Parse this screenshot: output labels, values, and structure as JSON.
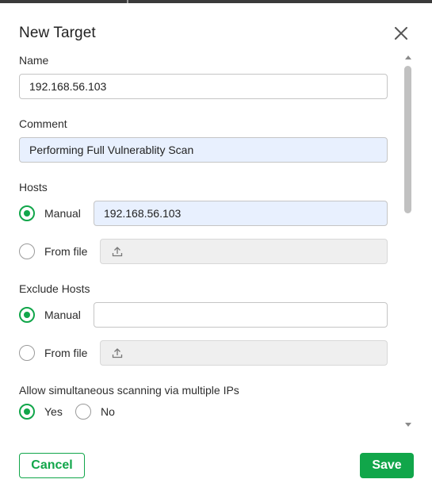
{
  "dialog": {
    "title": "New Target",
    "close_icon": "close-icon"
  },
  "fields": {
    "name": {
      "label": "Name",
      "value": "192.168.56.103"
    },
    "comment": {
      "label": "Comment",
      "value": "Performing Full Vulnerablity Scan"
    },
    "hosts": {
      "label": "Hosts",
      "manual_label": "Manual",
      "manual_value": "192.168.56.103",
      "from_file_label": "From file",
      "selected": "manual"
    },
    "exclude_hosts": {
      "label": "Exclude Hosts",
      "manual_label": "Manual",
      "manual_value": "",
      "from_file_label": "From file",
      "selected": "manual"
    },
    "simultaneous": {
      "label": "Allow simultaneous scanning via multiple IPs",
      "yes_label": "Yes",
      "no_label": "No",
      "selected": "yes"
    }
  },
  "buttons": {
    "cancel": "Cancel",
    "save": "Save"
  },
  "colors": {
    "accent": "#11a64a",
    "autofill": "#e8f0fe",
    "disabled": "#efefef"
  }
}
